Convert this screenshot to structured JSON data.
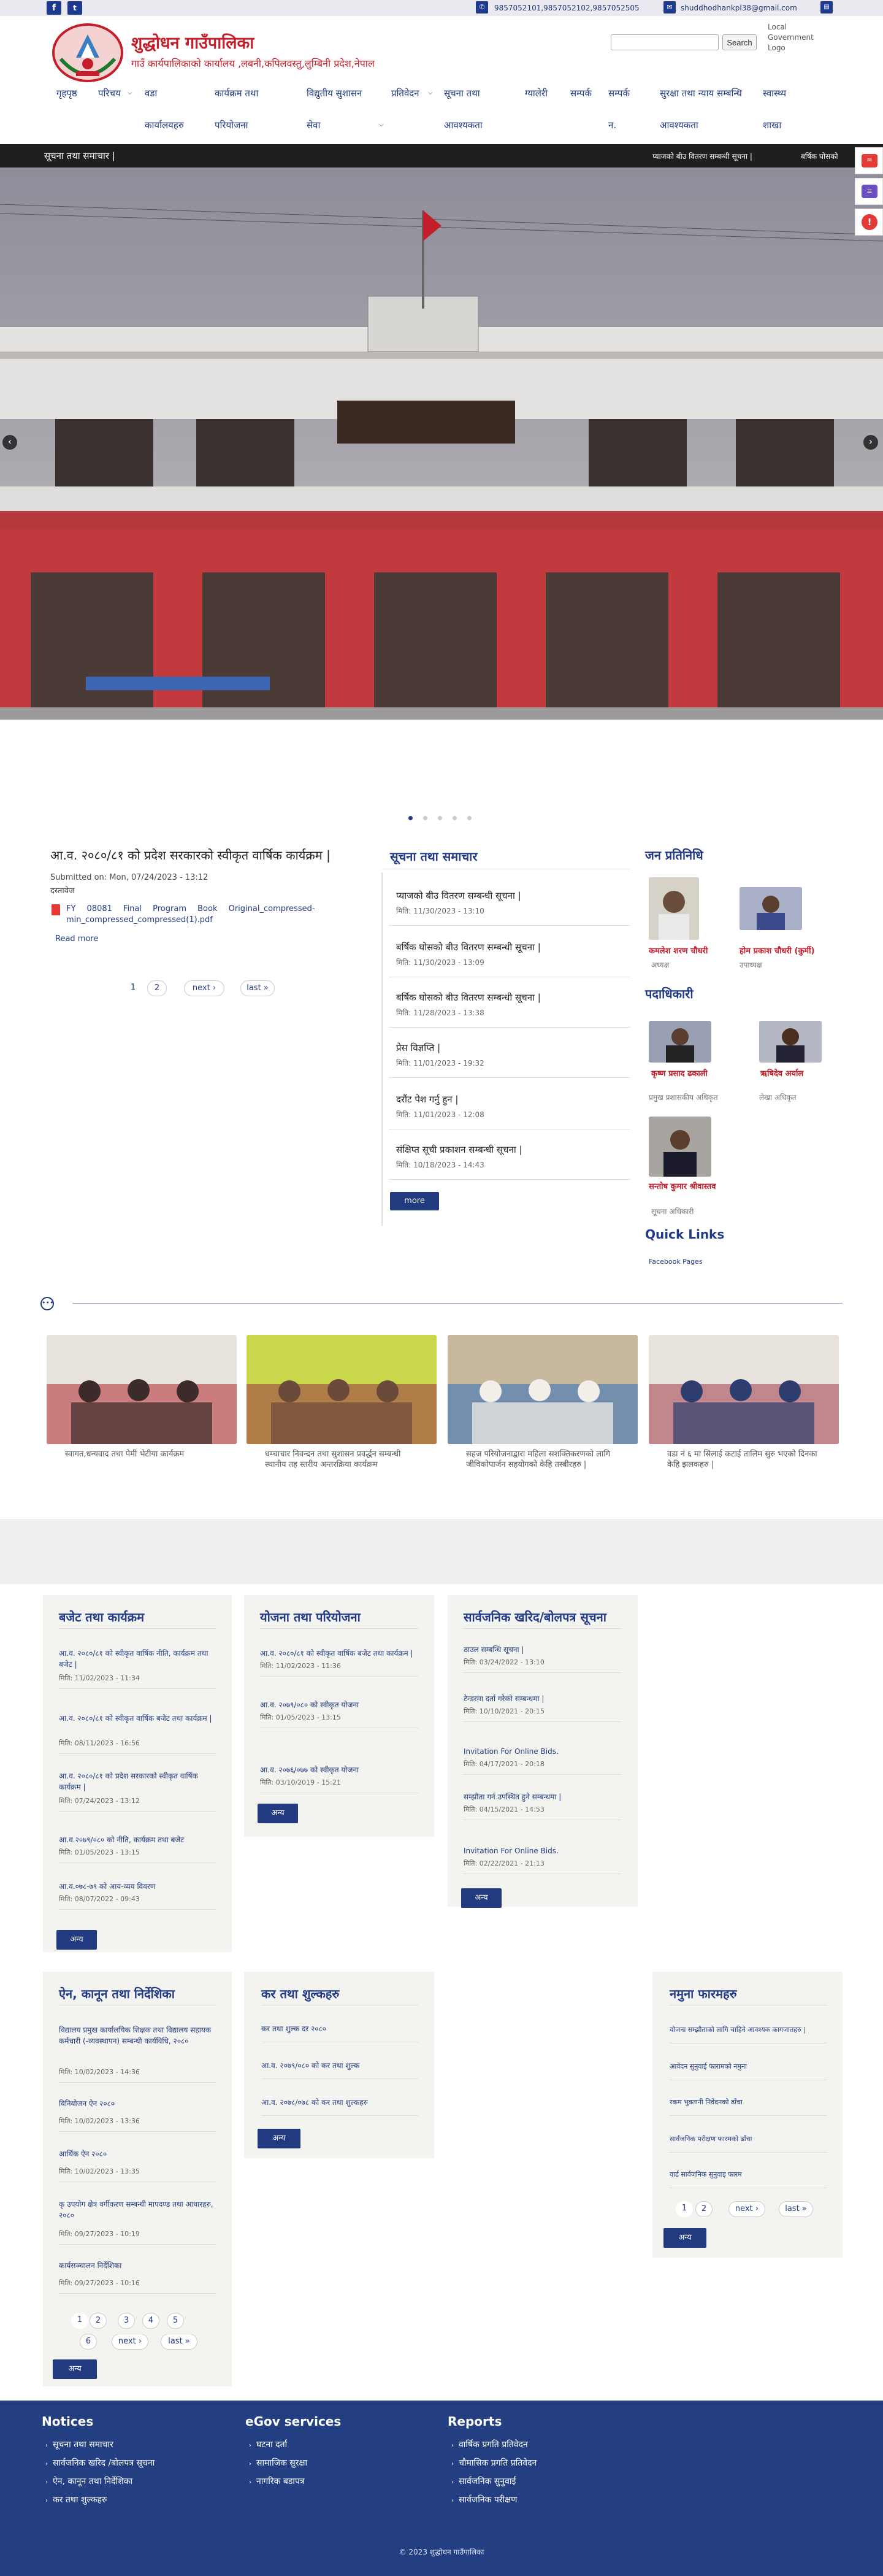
{
  "topbar": {
    "phone": "9857052101,9857052102,9857052505",
    "email": "shuddhodhankpl38@gmail.com"
  },
  "header": {
    "title": "शुद्धोधन गाउँपालिका",
    "subtitle": "गाउँ कार्यपालिकाको कार्यालय ,लबनी,कपिलवस्तु,लुम्बिनी प्रदेश,नेपाल",
    "search_button": "Search",
    "gov_logo_alt": "Local Government Logo"
  },
  "nav": [
    {
      "l1": "गृहपृष्ठ",
      "l2": ""
    },
    {
      "l1": "परिचय",
      "l2": ""
    },
    {
      "l1": "वडा",
      "l2": "कार्यालयहरु"
    },
    {
      "l1": "कार्यक्रम तथा",
      "l2": "परियोजना"
    },
    {
      "l1": "विद्युतीय सुशासन",
      "l2": "सेवा"
    },
    {
      "l1": "प्रतिवेदन",
      "l2": ""
    },
    {
      "l1": "सूचना तथा",
      "l2": "आवश्यकता"
    },
    {
      "l1": "ग्यालेरी",
      "l2": ""
    },
    {
      "l1": "सम्पर्क",
      "l2": ""
    },
    {
      "l1": "सम्पर्क",
      "l2": "न."
    },
    {
      "l1": "सुरक्षा तथा न्याय सम्बन्धि",
      "l2": "आवश्यकता"
    },
    {
      "l1": "स्वास्थ्य",
      "l2": "शाखा"
    }
  ],
  "ticker": {
    "label": "सूचना तथा समाचार |",
    "items": [
      "प्याजको बीउ वितरण सम्बन्धी सूचना |",
      "बर्षिक घोसको"
    ]
  },
  "main_article": {
    "title": "आ.व. २०८०/८१ को प्रदेश सरकारको स्वीकृत वार्षिक कार्यक्रम |",
    "submitted": "Submitted on: Mon, 07/24/2023 - 13:12",
    "type": "दस्तावेज",
    "file": "FY 08081 Final Program Book Original_compressed-min_compressed_compressed(1).pdf",
    "readmore": "Read more",
    "pager": [
      "1",
      "2",
      "next ›",
      "last »"
    ]
  },
  "news": {
    "title": "सूचना तथा समाचार",
    "items": [
      {
        "title": "प्याजको बीउ वितरण सम्बन्धी सूचना |",
        "date": "मिति: 11/30/2023 - 13:10"
      },
      {
        "title": "बर्षिक घोसको बीउ वितरण सम्बन्धी सूचना |",
        "date": "मिति: 11/30/2023 - 13:09"
      },
      {
        "title": "बर्षिक घोसको बीउ वितरण सम्बन्धी सूचना |",
        "date": "मिति: 11/28/2023 - 13:38"
      },
      {
        "title": "प्रेस विज्ञप्ति |",
        "date": "मिति: 11/01/2023 - 19:32"
      },
      {
        "title": "दरौंट पेश गर्नु हुन |",
        "date": "मिति: 11/01/2023 - 12:08"
      },
      {
        "title": "संक्षिप्त सूची प्रकाशन सम्बन्धी सूचना |",
        "date": "मिति: 10/18/2023 - 14:43"
      }
    ],
    "more": "more"
  },
  "representatives": {
    "title": "जन प्रतिनिधि",
    "people": [
      {
        "name": "कमलेश शरण चौधरी",
        "role": "अध्यक्ष"
      },
      {
        "name": "होम प्रकाश चौधरी (कुर्मी)",
        "role": "उपाध्यक्ष"
      }
    ]
  },
  "officials": {
    "title": "पदाधिकारी",
    "people": [
      {
        "name": "कृष्ण प्रसाद ढकाली",
        "role": "प्रमुख प्रशासकीय अधिकृत"
      },
      {
        "name": "ऋषिदेव अर्याल",
        "role": "लेखा अधिकृत"
      },
      {
        "name": "सन्तोष कुमार श्रीवास्तव",
        "role": "सूचना अधिकारी"
      }
    ]
  },
  "quicklinks": {
    "title": "Quick Links",
    "items": [
      "Facebook Pages"
    ]
  },
  "gallery": [
    {
      "caption": "स्वागत,धन्यवाद तथा पेमी भेटीया कार्यक्रम"
    },
    {
      "caption": "धम्चाचार निवन्दन तथा सुशासन प्रवर्द्धन सम्बन्धी स्थानीय तह स्तरीय अन्तरक्रिया कार्यक्रम"
    },
    {
      "caption": "सहज परियोजनाद्वारा महिला सशक्तिकरणको लागि जीविकोपार्जन सहयोगको केहि तस्बीरहरु |"
    },
    {
      "caption": "वडा नं ६ मा सिलाई कटाई तालिम सुरु भएको दिनका केहि झलकहरु |"
    }
  ],
  "cards_row1": [
    {
      "title": "बजेट तथा कार्यक्रम",
      "items": [
        {
          "title": "आ.व. २०८०/८१ को स्वीकृत वार्षिक नीति, कार्यक्रम तथा बजेट |",
          "date": "मिति: 11/02/2023 - 11:34"
        },
        {
          "title": "आ.व. २०८०/८१ को स्वीकृत वार्षिक बजेट तथा कार्यक्रम |",
          "date": "मिति: 08/11/2023 - 16:56"
        },
        {
          "title": "आ.व. २०८०/८१ को प्रदेश सरकारको स्वीकृत वार्षिक कार्यक्रम |",
          "date": "मिति: 07/24/2023 - 13:12"
        },
        {
          "title": "आ.व.२०७९/०८० को नीति, कार्यक्रम तथा बजेट",
          "date": "मिति: 01/05/2023 - 13:15"
        },
        {
          "title": "आ.व.०७८-७९ को आय-व्यय विवरण",
          "date": "मिति: 08/07/2022 - 09:43"
        }
      ],
      "more": "अन्य"
    },
    {
      "title": "योजना तथा परियोजना",
      "items": [
        {
          "title": "आ.व. २०८०/८१ को स्वीकृत वार्षिक बजेट तथा कार्यक्रम |",
          "date": "मिति: 11/02/2023 - 11:36"
        },
        {
          "title": "आ.व. २०७९/०८० को स्वीकृत योजना",
          "date": "मिति: 01/05/2023 - 13:15"
        },
        {
          "title": "आ.व. २०७६/०७७ को स्वीकृत योजना",
          "date": "मिति: 03/10/2019 - 15:21"
        }
      ],
      "more": "अन्य"
    },
    {
      "title": "सार्वजनिक खरिद/बोलपत्र सूचना",
      "items": [
        {
          "title": "ठाउल सम्बन्धि सूचना |",
          "date": "मिति: 03/24/2022 - 13:10"
        },
        {
          "title": "टेन्डरमा दर्ता गरेको सम्बन्धमा |",
          "date": "मिति: 10/10/2021 - 20:15"
        },
        {
          "title": "Invitation For Online Bids.",
          "date": "मिति: 04/17/2021 - 20:18"
        },
        {
          "title": "सम्झौता गर्न उपस्थित हुने सम्बन्धमा |",
          "date": "मिति: 04/15/2021 - 14:53"
        },
        {
          "title": "Invitation For Online Bids.",
          "date": "मिति: 02/22/2021 - 21:13"
        }
      ],
      "more": "अन्य"
    }
  ],
  "laws": {
    "title": "ऐन, कानून तथा निर्देशिका",
    "items": [
      {
        "title": "विद्यालय प्रमुख कार्यालयिक शिक्षक तथा विद्यालय सहायक कर्मचारी (-व्यवस्थापन) सम्बन्धी कार्यविधि, २०८०",
        "date": "मिति: 10/02/2023 - 14:36"
      },
      {
        "title": "विनियोजन ऐन २०८०",
        "date": "मिति: 10/02/2023 - 13:36"
      },
      {
        "title": "आर्थिक ऐन २०८०",
        "date": "मिति: 10/02/2023 - 13:35"
      },
      {
        "title": "कृ उपयोग क्षेत्र वर्गीकरण सम्बन्धी मापदण्ड तथा आधारहरु, २०८०",
        "date": "मिति: 09/27/2023 - 10:19"
      },
      {
        "title": "कार्यसञ्चालन निर्देशिका",
        "date": "मिति: 09/27/2023 - 10:16"
      }
    ],
    "pager": [
      "1",
      "2",
      "3",
      "4",
      "5",
      "6",
      "next ›",
      "last »"
    ],
    "more": "अन्य"
  },
  "tax": {
    "title": "कर तथा शुल्कहरु",
    "items": [
      {
        "title": "कर तथा शुल्क दर २०८०"
      },
      {
        "title": "आ.व. २०७९/०८० को कर तथा शुल्क"
      },
      {
        "title": "आ.व. २०७८/०७८ को कर तथा शुल्कहरु"
      }
    ],
    "more": "अन्य"
  },
  "forms": {
    "title": "नमुना फारमहरु",
    "items": [
      {
        "title": "योजना सम्झौताको लागि चाहिने आवश्यक कागजातहरु |"
      },
      {
        "title": "आवेदन सुनुवाई फारामको नमुना"
      },
      {
        "title": "रकम भुक्तानी निवेदनको ढाँचा"
      },
      {
        "title": "सार्वजनिक परीक्षण फारमको ढाँचा"
      },
      {
        "title": "वार्ड सार्वजनिक सुनुवाइ फारम"
      }
    ],
    "pager": [
      "1",
      "2",
      "next ›",
      "last »"
    ],
    "more": "अन्य"
  },
  "footer": {
    "cols": [
      {
        "title": "Notices",
        "items": [
          "सूचना तथा समाचार",
          "सार्वजनिक खरिद /बोलपत्र सूचना",
          "ऐन, कानून तथा निर्देशिका",
          "कर तथा शुल्कहरु"
        ]
      },
      {
        "title": "eGov services",
        "items": [
          "घटना दर्ता",
          "सामाजिक सुरक्षा",
          "नागरिक बडापत्र"
        ]
      },
      {
        "title": "Reports",
        "items": [
          "वार्षिक प्रगति प्रतिवेदन",
          "चौमासिक प्रगति प्रतिवेदन",
          "सार्वजनिक सुनुवाई",
          "सार्वजनिक परीक्षण"
        ]
      }
    ],
    "copyright": "© 2023 शुद्धोधन गाउँपालिका"
  },
  "colors": {
    "primary": "#223a80",
    "brand_red": "#c41e2a",
    "footer": "#233f82"
  }
}
